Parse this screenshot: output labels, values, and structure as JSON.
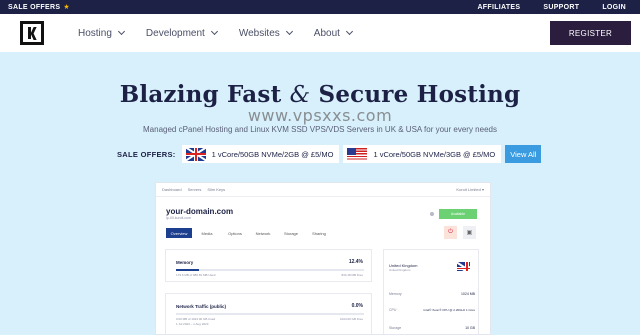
{
  "topbar": {
    "sale_offers": "SALE OFFERS",
    "links": [
      "AFFILIATES",
      "SUPPORT",
      "LOGIN"
    ]
  },
  "nav": {
    "menu": [
      "Hosting",
      "Development",
      "Websites",
      "About"
    ],
    "register": "REGISTER"
  },
  "hero": {
    "title_part1": "Blazing Fast",
    "title_amp": "&",
    "title_part2": "Secure Hosting",
    "watermark": "www.vpsxxs.com",
    "subtitle": "Managed cPanel Hosting and Linux KVM SSD VPS/VDS Servers in UK & USA for your every needs"
  },
  "sale": {
    "label": "SALE OFFERS:",
    "offer_uk": "1 vCore/50GB NVMe/2GB @ £5/MO",
    "offer_us": "1 vCore/50GB NVMe/3GB @ £5/MO",
    "view_all": "View All"
  },
  "dashboard": {
    "crumbs": [
      "Dashboard",
      "Servers",
      "Slim Keys"
    ],
    "user": "Kuroit Limited ▾",
    "domain": "your-domain.com",
    "domain_sub": "ip-00.kuroit.com",
    "status": "Available",
    "tabs": [
      "Overview",
      "Media",
      "Options",
      "Network",
      "Storage",
      "Sharing"
    ],
    "memory": {
      "title": "Memory",
      "value": "12.4%",
      "percent": 12.4,
      "foot_left": "179.6 MB of 980.81 MB Used",
      "foot_right": "844.18 MB Free"
    },
    "network": {
      "title": "Network Traffic (public)",
      "value": "0.0%",
      "percent": 0.0,
      "foot_left": "0.00 MB of 1024.00 GB Used",
      "foot_right": "1024.00 GB Free",
      "foot_sub": "1 Jul 2023 – 1 Aug 2023"
    },
    "location": {
      "name": "United Kingdom",
      "sub": "United Kingdom"
    },
    "specs": [
      {
        "label": "Memory",
        "value": "1024 MB"
      },
      {
        "label": "CPU",
        "value": "Intel® Xeon® CPU @ 2.20GHz  1 Core"
      },
      {
        "label": "Storage",
        "value": "10 GB"
      }
    ]
  }
}
